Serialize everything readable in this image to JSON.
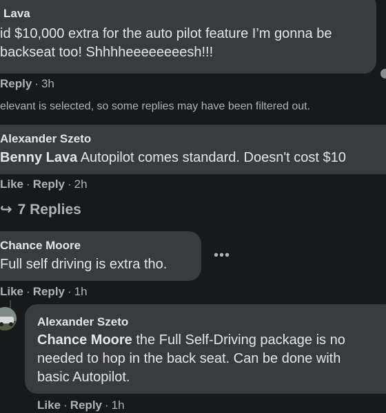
{
  "comment1": {
    "author": "Lava",
    "line1": "id $10,000 extra for the auto pilot feature I’m gonna be",
    "line2": "backseat too! Shhhheeeeeeeesh!!!",
    "reply_label": "Reply",
    "time": "3h"
  },
  "filter_notice": "elevant is selected, so some replies may have been filtered out.",
  "comment2": {
    "author": "Alexander Szeto",
    "mention": "Benny Lava",
    "text": " Autopilot comes standard. Doesn't cost $10",
    "like_label": "Like",
    "reply_label": "Reply",
    "time": "2h"
  },
  "replies_link": {
    "arrow": "↪",
    "label": "7 Replies"
  },
  "comment3": {
    "author": "Chance Moore",
    "text": "Full self driving is extra tho.",
    "more": "•••",
    "like_label": "Like",
    "reply_label": "Reply",
    "time": "1h"
  },
  "comment4": {
    "author": "Alexander Szeto",
    "mention": "Chance Moore",
    "line1": " the Full Self-Driving package is no",
    "line2": "needed to hop in the back seat. Can be done with",
    "line3": "basic Autopilot.",
    "like_label": "Like",
    "reply_label": "Reply",
    "time": "1h"
  },
  "colors": {
    "background": "#18191a",
    "bubble": "#3a3b3c",
    "text": "#e4e6eb",
    "secondary": "#b0b3b8"
  }
}
